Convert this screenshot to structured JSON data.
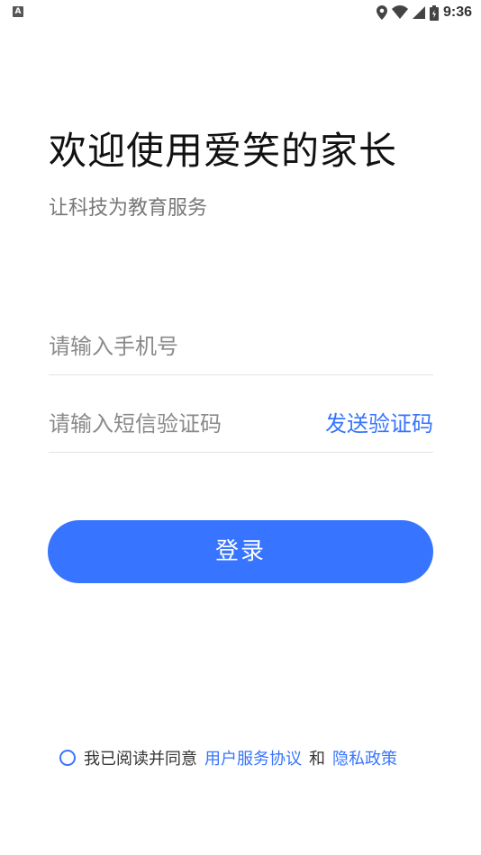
{
  "status_bar": {
    "left_icon": "A",
    "time": "9:36",
    "icons": [
      "location-icon",
      "wifi-icon",
      "signal-icon",
      "battery-icon"
    ]
  },
  "header": {
    "title": "欢迎使用爱笑的家长",
    "subtitle": "让科技为教育服务"
  },
  "form": {
    "phone_placeholder": "请输入手机号",
    "code_placeholder": "请输入短信验证码",
    "send_code_label": "发送验证码",
    "login_label": "登录"
  },
  "agreement": {
    "prefix": "我已阅读并同意",
    "user_agreement": "用户服务协议",
    "and": "和",
    "privacy_policy": "隐私政策",
    "checked": false
  },
  "colors": {
    "accent": "#3774ff",
    "text": "#111111",
    "muted": "#777777"
  }
}
